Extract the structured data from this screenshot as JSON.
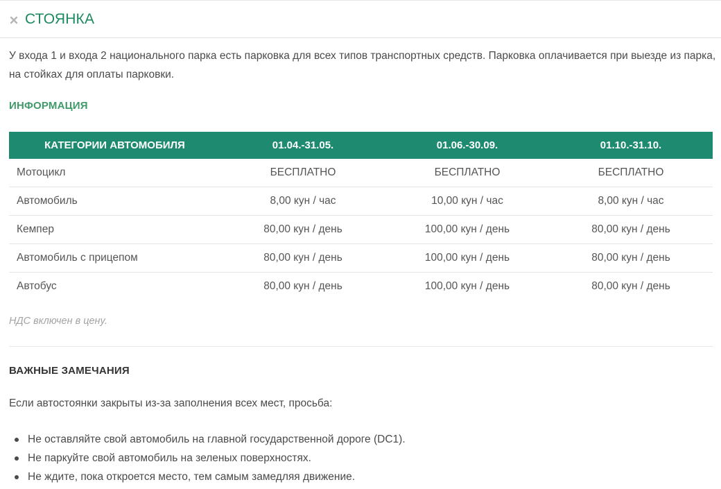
{
  "header": {
    "title": "СТОЯНКА",
    "close_icon": "close-icon"
  },
  "intro": "У входа 1 и входа 2 национального парка есть парковка для всех типов транспортных средств. Парковка оплачивается при выезде из парка, на стойках для оплаты парковки.",
  "info_title": "ИНФОРМАЦИЯ",
  "table": {
    "headers": [
      "КАТЕГОРИИ АВТОМОБИЛЯ",
      "01.04.-31.05.",
      "01.06.-30.09.",
      "01.10.-31.10."
    ],
    "rows": [
      [
        "Мотоцикл",
        "БЕСПЛАТНО",
        "БЕСПЛАТНО",
        "БЕСПЛАТНО"
      ],
      [
        "Автомобиль",
        "8,00 кун / час",
        "10,00 кун / час",
        "8,00 кун / час"
      ],
      [
        "Кемпер",
        "80,00 кун / день",
        "100,00 кун / день",
        "80,00 кун / день"
      ],
      [
        "Автомобиль с прицепом",
        "80,00 кун / день",
        "100,00 кун / день",
        "80,00 кун / день"
      ],
      [
        "Автобус",
        "80,00 кун / день",
        "100,00 кун / день",
        "80,00 кун / день"
      ]
    ]
  },
  "vat_note": "НДС включен в цену.",
  "notes": {
    "title": "ВАЖНЫЕ ЗАМЕЧАНИЯ",
    "lead": "Если автостоянки закрыты из-за заполнения всех мест, просьба:",
    "items": [
      "Не оставляйте свой автомобиль на главной государственной дороге (DC1).",
      "Не паркуйте свой автомобиль на зеленых поверхностях.",
      "Не ждите, пока откроется место, тем самым замедляя движение."
    ]
  },
  "colors": {
    "accent": "#1c8a5e",
    "table_header": "#1e8a70",
    "section_green": "#3f9a6a",
    "muted": "#a3a3a3"
  }
}
